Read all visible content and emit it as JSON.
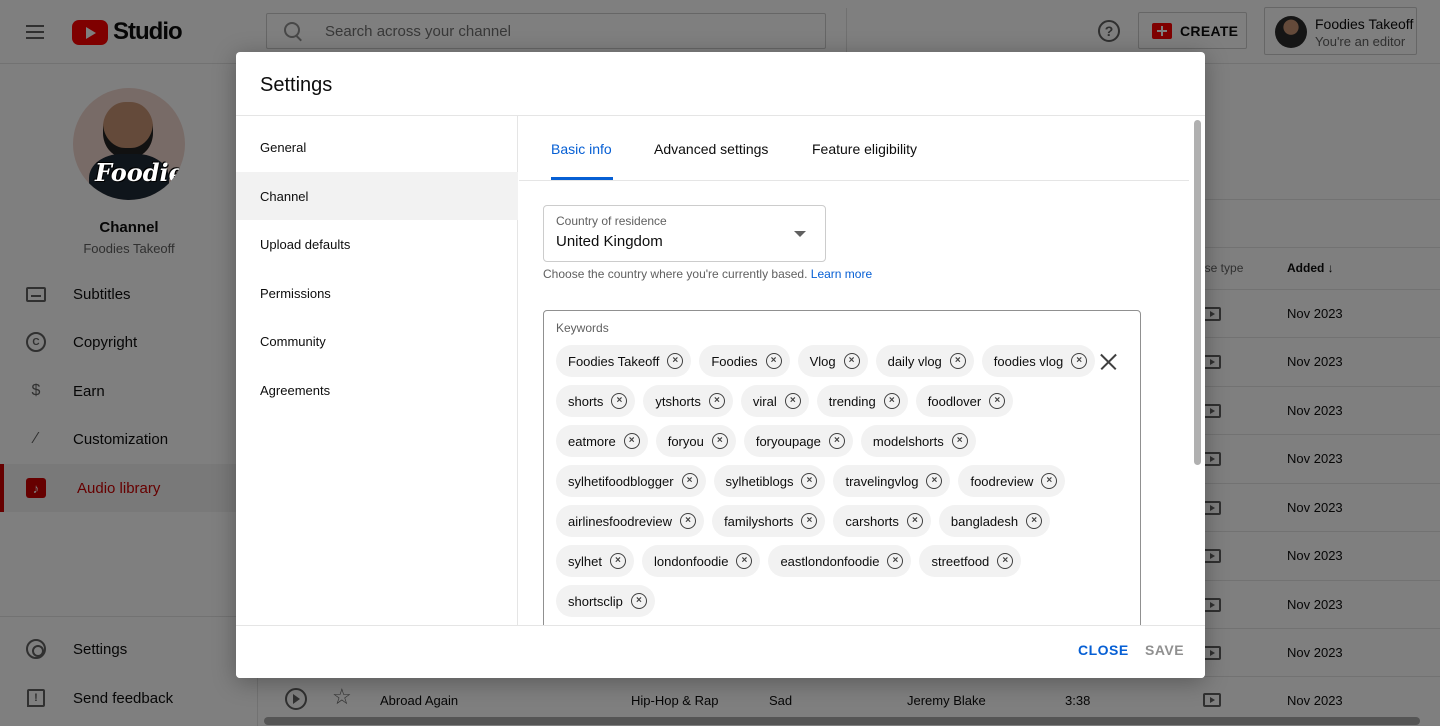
{
  "app": {
    "logo_text": "Studio"
  },
  "search": {
    "placeholder": "Search across your channel"
  },
  "header": {
    "help_icon": "?",
    "create_label": "CREATE",
    "account_name": "Foodies Takeoff",
    "account_role": "You're an editor"
  },
  "sidebar": {
    "avatar_text": "Foodies",
    "channel_label": "Channel",
    "channel_name": "Foodies Takeoff",
    "items": [
      {
        "label": "Subtitles",
        "icon": "subtitles-icon"
      },
      {
        "label": "Copyright",
        "icon": "copyright-icon"
      },
      {
        "label": "Earn",
        "icon": "dollar-icon"
      },
      {
        "label": "Customization",
        "icon": "magic-wand-icon"
      },
      {
        "label": "Audio library",
        "icon": "audio-library-icon",
        "active": true
      }
    ],
    "bottom_items": [
      {
        "label": "Settings",
        "icon": "gear-icon"
      },
      {
        "label": "Send feedback",
        "icon": "feedback-icon"
      }
    ]
  },
  "table": {
    "headers": {
      "license_type_partial": "nse type",
      "added": "Added"
    },
    "dates": [
      "Nov 2023",
      "Nov 2023",
      "Nov 2023",
      "Nov 2023",
      "Nov 2023",
      "Nov 2023",
      "Nov 2023",
      "Nov 2023",
      "Nov 2023"
    ],
    "last_row": {
      "title": "Abroad Again",
      "genre": "Hip-Hop & Rap",
      "mood": "Sad",
      "artist": "Jeremy Blake",
      "duration": "3:38",
      "added": "Nov 2023"
    }
  },
  "dialog": {
    "title": "Settings",
    "nav": [
      {
        "label": "General"
      },
      {
        "label": "Channel",
        "selected": true
      },
      {
        "label": "Upload defaults"
      },
      {
        "label": "Permissions"
      },
      {
        "label": "Community"
      },
      {
        "label": "Agreements"
      }
    ],
    "tabs": [
      {
        "label": "Basic info",
        "active": true
      },
      {
        "label": "Advanced settings"
      },
      {
        "label": "Feature eligibility"
      }
    ],
    "country": {
      "label": "Country of residence",
      "value": "United Kingdom",
      "hint": "Choose the country where you're currently based.",
      "learn_more": "Learn more"
    },
    "keywords": {
      "label": "Keywords",
      "chips": [
        "Foodies Takeoff",
        "Foodies",
        "Vlog",
        "daily vlog",
        "foodies vlog",
        "shorts",
        "ytshorts",
        "viral",
        "trending",
        "foodlover",
        "eatmore",
        "foryou",
        "foryoupage",
        "modelshorts",
        "sylhetifoodblogger",
        "sylhetiblogs",
        "travelingvlog",
        "foodreview",
        "airlinesfoodreview",
        "familyshorts",
        "carshorts",
        "bangladesh",
        "sylhet",
        "londonfoodie",
        "eastlondonfoodie",
        "streetfood",
        "shortsclip"
      ]
    },
    "footer": {
      "close_label": "CLOSE",
      "save_label": "SAVE"
    }
  }
}
